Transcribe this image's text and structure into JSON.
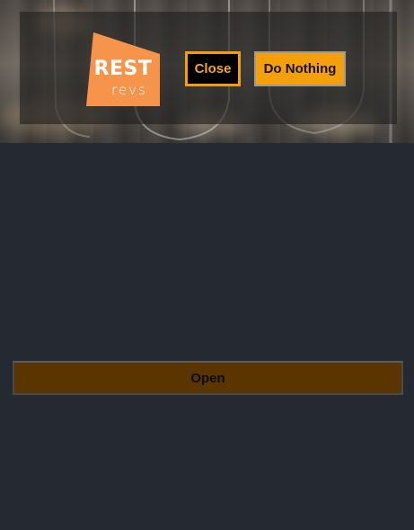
{
  "logo": {
    "line1": "REST",
    "line2": "revs",
    "color": "#f5944a"
  },
  "header": {
    "close_label": "Close",
    "do_nothing_label": "Do Nothing"
  },
  "main": {
    "open_label": "Open"
  },
  "colors": {
    "page_background": "#252932",
    "accent": "#f5a00a",
    "open_button": "#5a3500"
  }
}
